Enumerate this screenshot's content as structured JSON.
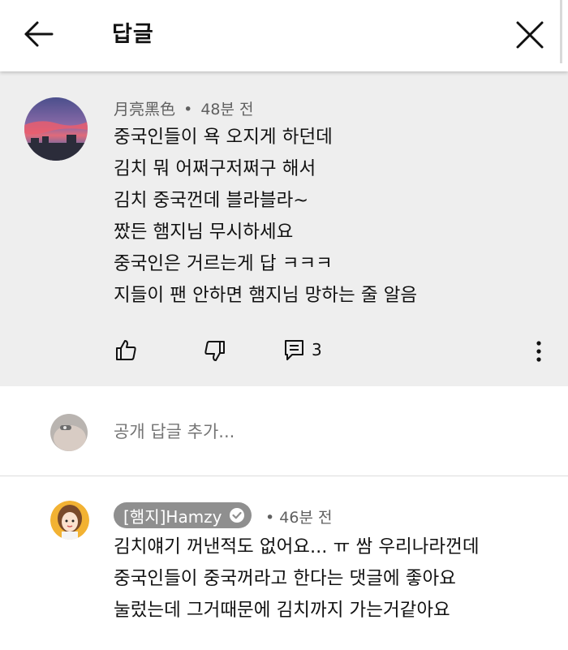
{
  "header": {
    "title": "답글",
    "back_icon": "arrow-left-icon",
    "close_icon": "close-icon"
  },
  "parent_comment": {
    "author": "月亮黑色",
    "separator": "•",
    "time": "48분 전",
    "lines": [
      "중국인들이 욕 오지게 하던데",
      "김치 뭐 어쩌구저쩌구 해서",
      "김치 중국껀데 블라블라~",
      "짰든 햄지님 무시하세요",
      "중국인은 거르는게 답 ㅋㅋㅋ",
      "지들이 팬 안하면 햄지님 망하는 줄 알음"
    ],
    "reply_count": "3"
  },
  "add_reply": {
    "placeholder": "공개 답글 추가..."
  },
  "reply": {
    "author": "[햄지]Hamzy",
    "separator": "•",
    "time": "46분 전",
    "lines": [
      "김치얘기 꺼낸적도 없어요... ㅠ  쌈 우리나라껀데",
      "중국인들이 중국꺼라고 한다는 댓글에 좋아요",
      "눌렀는데 그거때문에 김치까지 가는거같아요"
    ]
  },
  "colors": {
    "parent_bg": "#eeeeee",
    "meta_text": "#606060",
    "author_chip_bg": "#8f8f8f"
  }
}
